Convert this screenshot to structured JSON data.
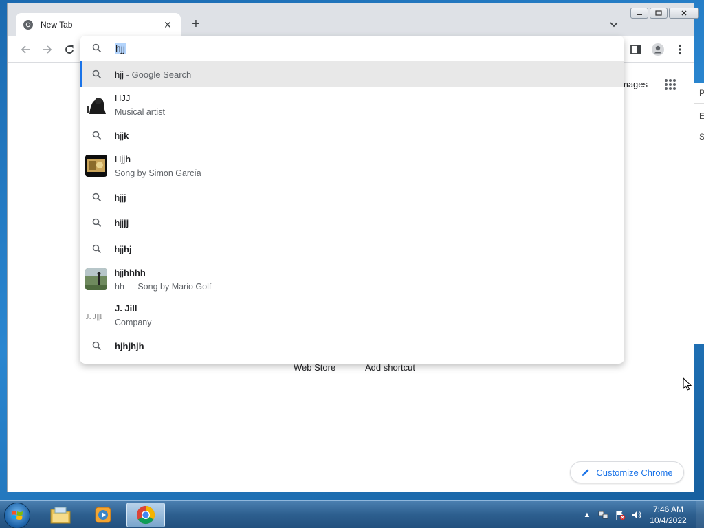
{
  "browser": {
    "tab_title": "New Tab",
    "tab_close": "✕",
    "new_tab": "+"
  },
  "omnibox": {
    "query": "hjj",
    "suggestions": [
      {
        "kind": "search",
        "prefix": "hjj",
        "bold": "",
        "desc": " - Google Search",
        "icon": "search-icon"
      },
      {
        "kind": "entity",
        "title": "HJJ",
        "subtitle": "Musical artist",
        "icon": "artist-thumbnail"
      },
      {
        "kind": "search",
        "prefix": "hjj",
        "bold": "k",
        "icon": "search-icon"
      },
      {
        "kind": "entity",
        "prefix": "Hjj",
        "bold": "h",
        "subtitle": "Song by Simon García",
        "icon": "song-thumbnail"
      },
      {
        "kind": "search",
        "prefix": "hjj",
        "bold": "j",
        "icon": "search-icon"
      },
      {
        "kind": "search",
        "prefix": "hjj",
        "bold": "jj",
        "icon": "search-icon"
      },
      {
        "kind": "search",
        "prefix": "hjj",
        "bold": "hj",
        "icon": "search-icon"
      },
      {
        "kind": "entity",
        "prefix": "hjj",
        "bold": "hhhh",
        "subtitle": "hh — Song by Mario Golf",
        "icon": "video-thumbnail"
      },
      {
        "kind": "entity",
        "bold_title": "J. Jill",
        "subtitle": "Company",
        "icon": "company-logo"
      },
      {
        "kind": "search",
        "prefix": "",
        "bold": "hjhjhjh",
        "icon": "search-icon"
      }
    ]
  },
  "page": {
    "images_link": "mages",
    "shortcuts": [
      "Web Store",
      "Add shortcut"
    ],
    "customize_label": "Customize Chrome"
  },
  "taskbar": {
    "time": "7:46 AM",
    "date": "10/4/2022"
  },
  "background_window": {
    "fragments": [
      "Pa",
      "E",
      "S"
    ]
  },
  "colors": {
    "accent": "#1a73e8",
    "selected_row": "#e8e8e8",
    "query_highlight": "#b3d4fc"
  }
}
